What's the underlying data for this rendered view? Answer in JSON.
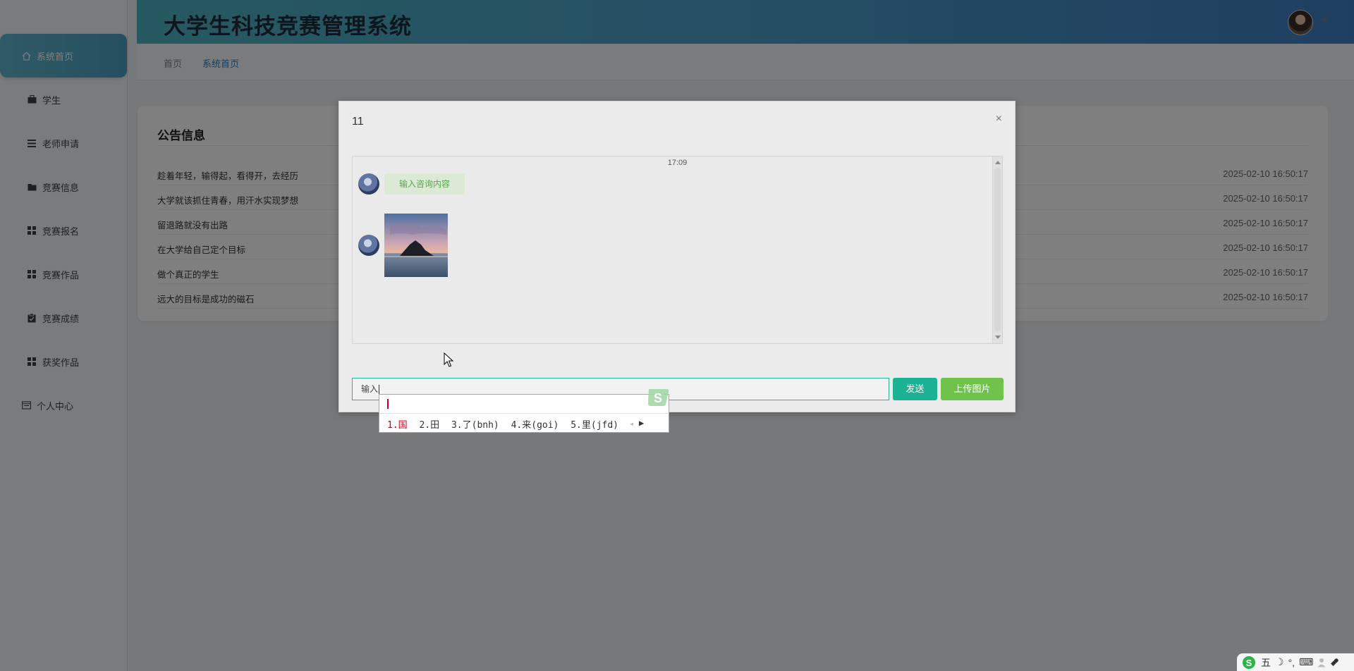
{
  "app": {
    "title": "大学生科技竞赛管理系统"
  },
  "sidebar": {
    "items": [
      {
        "label": "系统首页",
        "icon": "home-icon",
        "active": true
      },
      {
        "label": "学生",
        "icon": "briefcase-icon"
      },
      {
        "label": "老师申请",
        "icon": "list-icon"
      },
      {
        "label": "竞赛信息",
        "icon": "folder-icon"
      },
      {
        "label": "竞赛报名",
        "icon": "grid-icon"
      },
      {
        "label": "竞赛作品",
        "icon": "grid-icon"
      },
      {
        "label": "竞赛成绩",
        "icon": "clipboard-icon"
      },
      {
        "label": "获奖作品",
        "icon": "grid-icon"
      },
      {
        "label": "个人中心",
        "icon": "id-card-icon"
      }
    ]
  },
  "breadcrumb": {
    "home": "首页",
    "current": "系统首页"
  },
  "notices": {
    "title": "公告信息",
    "items": [
      {
        "title": "趁着年轻，输得起，看得开，去经历",
        "date": "2025-02-10 16:50:17"
      },
      {
        "title": "大学就该抓住青春，用汗水实现梦想",
        "date": "2025-02-10 16:50:17"
      },
      {
        "title": "留退路就没有出路",
        "date": "2025-02-10 16:50:17"
      },
      {
        "title": "在大学给自己定个目标",
        "date": "2025-02-10 16:50:17"
      },
      {
        "title": "做个真正的学生",
        "date": "2025-02-10 16:50:17"
      },
      {
        "title": "远大的目标是成功的磁石",
        "date": "2025-02-10 16:50:17"
      }
    ]
  },
  "dialog": {
    "title": "11",
    "close_symbol": "×",
    "chat": {
      "time": "17:09",
      "messages": [
        {
          "type": "text",
          "content": "输入咨询内容"
        },
        {
          "type": "image"
        }
      ]
    },
    "input": {
      "value": "输入"
    },
    "send_label": "发送",
    "upload_label": "上传图片"
  },
  "ime": {
    "composition": "",
    "candidates": [
      "1.国",
      "2.田",
      "3.了(bnh)",
      "4.来(goi)",
      "5.里(jfd)"
    ],
    "prev_symbol": "◂",
    "next_symbol": "▶",
    "toolbar": [
      "S",
      "五",
      "☽",
      "°,",
      "⌨",
      "👤",
      "🔧"
    ]
  },
  "colors": {
    "accent_green": "#1bb394",
    "upload_green": "#6fc24a",
    "header_start": "#4fb3c2",
    "header_end": "#3f7fc2"
  }
}
